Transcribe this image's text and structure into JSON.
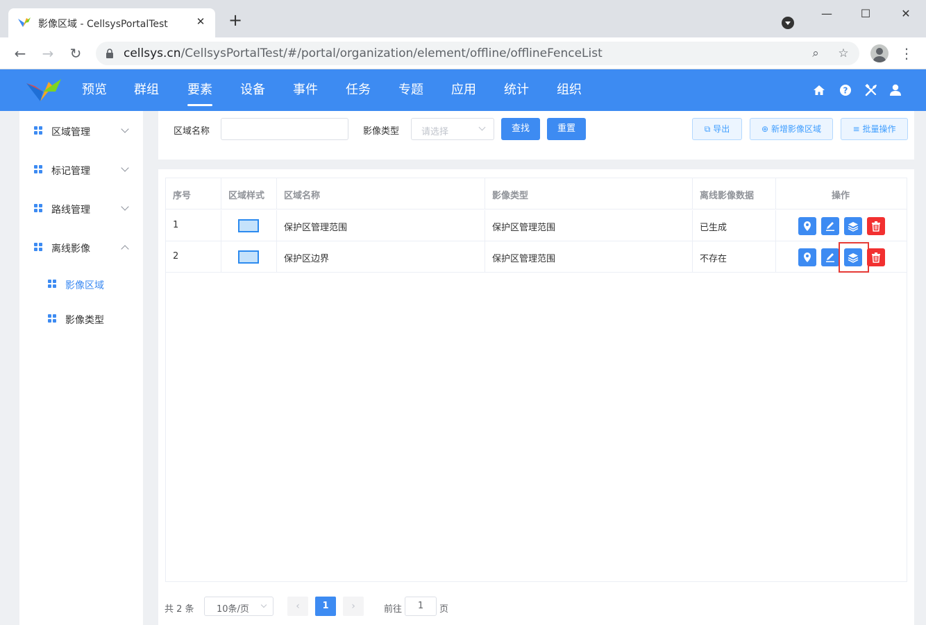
{
  "browser": {
    "tab_title": "影像区域 - CellsysPortalTest",
    "new_tab": "+",
    "url_host": "cellsys.cn",
    "url_path": "/CellsysPortalTest/#/portal/organization/element/offline/offlineFenceList"
  },
  "header": {
    "nav": [
      {
        "label": "预览"
      },
      {
        "label": "群组"
      },
      {
        "label": "要素"
      },
      {
        "label": "设备"
      },
      {
        "label": "事件"
      },
      {
        "label": "任务"
      },
      {
        "label": "专题"
      },
      {
        "label": "应用"
      },
      {
        "label": "统计"
      },
      {
        "label": "组织"
      }
    ],
    "active_nav": "要素",
    "icons": [
      "home-icon",
      "help-icon",
      "tools-icon",
      "user-icon"
    ]
  },
  "sidebar": {
    "groups": [
      {
        "label": "区域管理",
        "expanded": false
      },
      {
        "label": "标记管理",
        "expanded": false
      },
      {
        "label": "路线管理",
        "expanded": false
      },
      {
        "label": "离线影像",
        "expanded": true
      }
    ],
    "subitems": [
      {
        "label": "影像区域",
        "active": true
      },
      {
        "label": "影像类型",
        "active": false
      }
    ]
  },
  "search": {
    "name_label": "区域名称",
    "name_value": "",
    "type_label": "影像类型",
    "type_placeholder": "请选择",
    "find_label": "查找",
    "reset_label": "重置",
    "export_label": "导出",
    "add_label": "新增影像区域",
    "batch_label": "批量操作"
  },
  "table": {
    "headers": [
      "序号",
      "区域样式",
      "区域名称",
      "影像类型",
      "离线影像数据",
      "操作"
    ],
    "rows": [
      {
        "index": "1",
        "name": "保护区管理范围",
        "type": "保护区管理范围",
        "data": "已生成"
      },
      {
        "index": "2",
        "name": "保护区边界",
        "type": "保护区管理范围",
        "data": "不存在"
      }
    ]
  },
  "pagination": {
    "total_text": "共 2 条",
    "page_size": "10条/页",
    "current_page": "1",
    "goto_prefix": "前往",
    "goto_value": "1",
    "goto_suffix": "页"
  },
  "colors": {
    "primary": "#3d8bf2",
    "danger": "#f23030",
    "highlight": "#e53935"
  }
}
